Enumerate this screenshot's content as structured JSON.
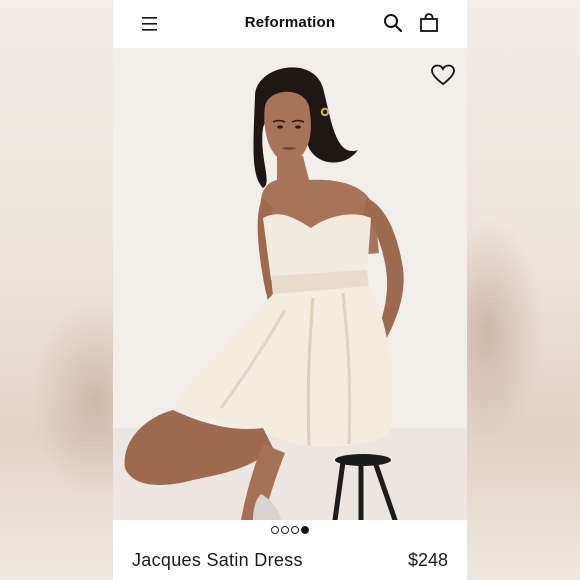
{
  "header": {
    "brand": "Reformation",
    "menu_icon": "hamburger-menu-icon",
    "search_icon": "search-icon",
    "bag_icon": "shopping-bag-icon"
  },
  "hero": {
    "wishlist_icon": "heart-icon",
    "carousel": {
      "total": 4,
      "active_index": 3
    }
  },
  "product": {
    "name": "Jacques Satin Dress",
    "price": "$248"
  },
  "colors": {
    "text": "#111111",
    "dress": "#f1e9dc",
    "skin": "#a9785c"
  }
}
